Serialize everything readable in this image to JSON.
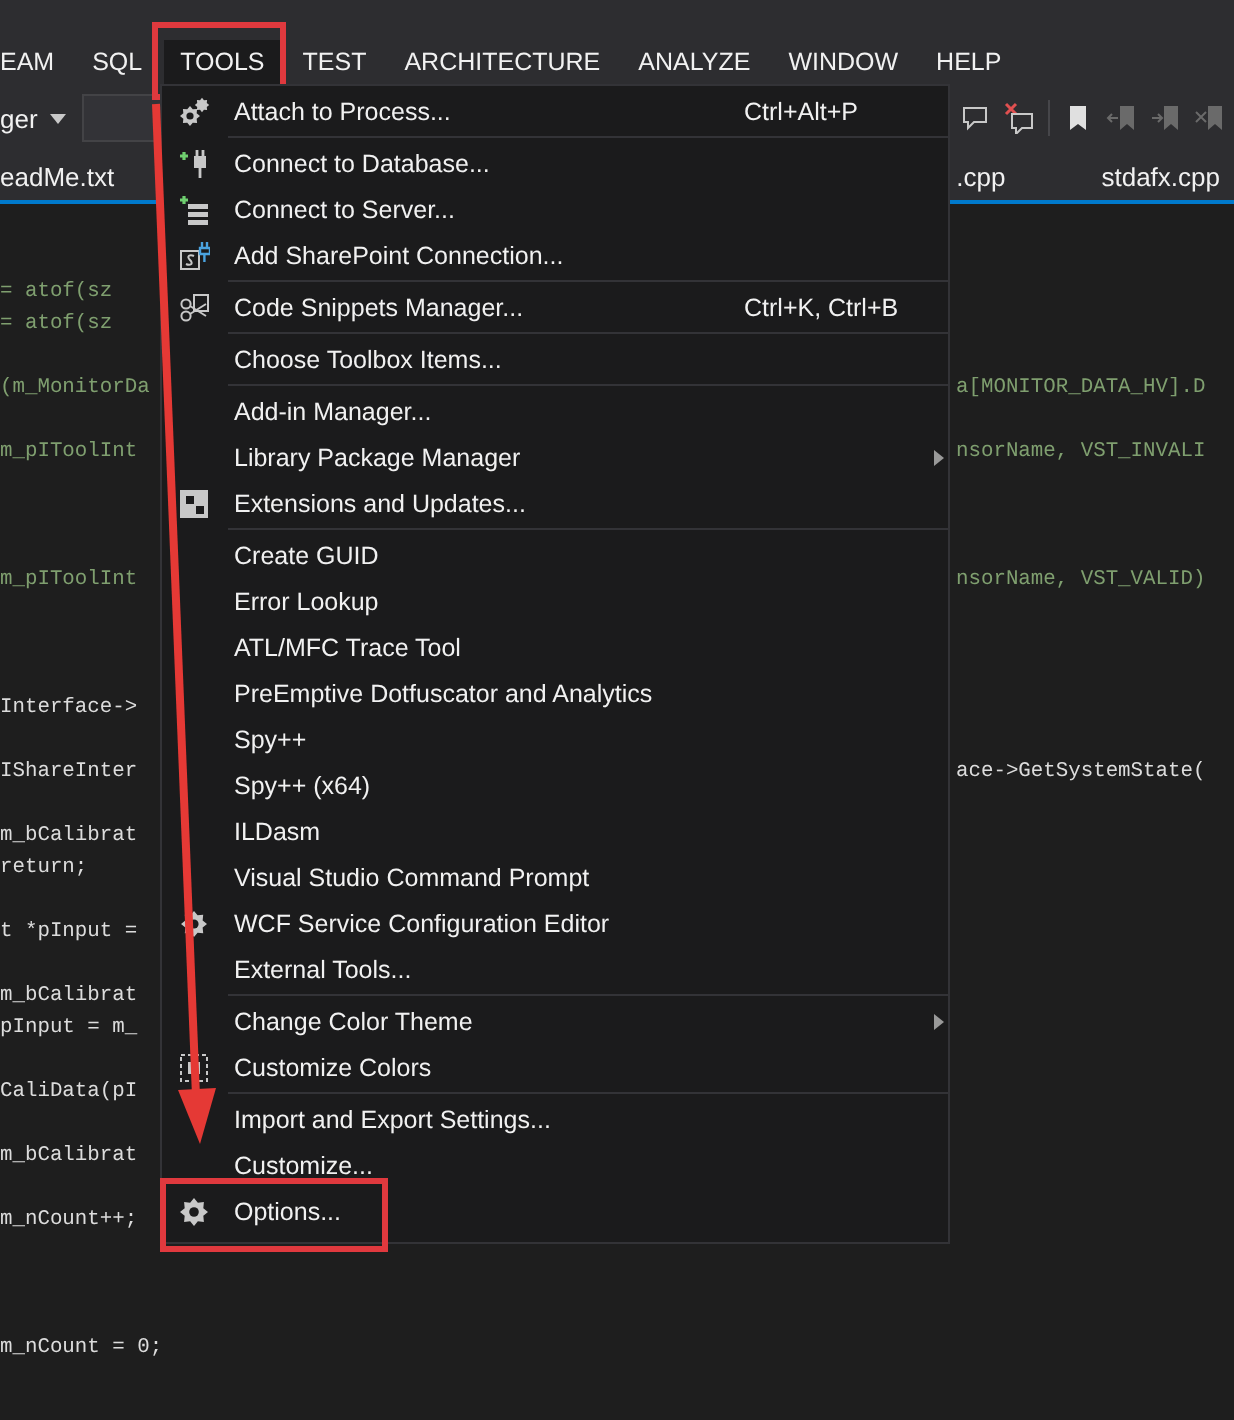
{
  "menu_bar": [
    {
      "label": "EAM",
      "selected": false,
      "highlighted": false
    },
    {
      "label": "SQL",
      "selected": false,
      "highlighted": false
    },
    {
      "label": "TOOLS",
      "selected": true,
      "highlighted": true
    },
    {
      "label": "TEST",
      "selected": false,
      "highlighted": false
    },
    {
      "label": "ARCHITECTURE",
      "selected": false,
      "highlighted": false
    },
    {
      "label": "ANALYZE",
      "selected": false,
      "highlighted": false
    },
    {
      "label": "WINDOW",
      "selected": false,
      "highlighted": false
    },
    {
      "label": "HELP",
      "selected": false,
      "highlighted": false
    }
  ],
  "toolbar": {
    "configuration": "ger"
  },
  "tabs": [
    {
      "label": "eadMe.txt"
    },
    {
      "label": ".cpp"
    },
    {
      "label": "stdafx.cpp"
    }
  ],
  "code_lines": [
    {
      "left": "= atof(sz",
      "inactive": true
    },
    {
      "left": "= atof(sz",
      "inactive": true
    },
    {
      "left": "(m_MonitorDa",
      "right": "a[MONITOR_DATA_HV].D",
      "inactive": true
    },
    {
      "left": "m_pIToolInt",
      "right": "nsorName, VST_INVALI",
      "inactive": true
    },
    {
      "left": "m_pIToolInt",
      "right": "nsorName, VST_VALID)",
      "inactive": true
    },
    {
      "left": "Interface->",
      "inactive": false
    },
    {
      "left": "IShareInter",
      "right": "ace->GetSystemState(",
      "inactive": false
    },
    {
      "left": "m_bCalibrat",
      "inactive": false
    },
    {
      "left": "return;",
      "inactive": false
    },
    {
      "left": "t *pInput =",
      "inactive": false
    },
    {
      "left": "m_bCalibrat",
      "inactive": false
    },
    {
      "left": "pInput = m_",
      "inactive": false
    },
    {
      "left": "CaliData(pI",
      "inactive": false
    },
    {
      "left": "m_bCalibrat",
      "inactive": false
    },
    {
      "left": "m_nCount++;",
      "inactive": false
    },
    {
      "left": "m_nCount = 0;",
      "inactive": false
    }
  ],
  "tools_menu": {
    "groups": [
      [
        {
          "label": "Attach to Process...",
          "shortcut": "Ctrl+Alt+P",
          "kind": "process",
          "submenu": false,
          "highlighted": false
        }
      ],
      [
        {
          "label": "Connect to Database...",
          "kind": "database",
          "submenu": false,
          "highlighted": false
        },
        {
          "label": "Connect to Server...",
          "kind": "server",
          "submenu": false,
          "highlighted": false
        },
        {
          "label": "Add SharePoint Connection...",
          "kind": "sharepoint",
          "submenu": false,
          "highlighted": false
        }
      ],
      [
        {
          "label": "Code Snippets Manager...",
          "shortcut": "Ctrl+K, Ctrl+B",
          "kind": "snippets",
          "submenu": false,
          "highlighted": false
        }
      ],
      [
        {
          "label": "Choose Toolbox Items...",
          "kind": "plain",
          "submenu": false,
          "highlighted": false
        }
      ],
      [
        {
          "label": "Add-in Manager...",
          "kind": "plain",
          "submenu": false,
          "highlighted": false
        },
        {
          "label": "Library Package Manager",
          "kind": "plain",
          "submenu": true,
          "highlighted": false
        },
        {
          "label": "Extensions and Updates...",
          "kind": "extensions",
          "submenu": false,
          "highlighted": false
        }
      ],
      [
        {
          "label": "Create GUID",
          "kind": "plain",
          "submenu": false,
          "highlighted": false
        },
        {
          "label": "Error Lookup",
          "kind": "plain",
          "submenu": false,
          "highlighted": false
        },
        {
          "label": "ATL/MFC Trace Tool",
          "kind": "plain",
          "submenu": false,
          "highlighted": false
        },
        {
          "label": "PreEmptive Dotfuscator and Analytics",
          "kind": "plain",
          "submenu": false,
          "highlighted": false
        },
        {
          "label": "Spy++",
          "kind": "plain",
          "submenu": false,
          "highlighted": false
        },
        {
          "label": "Spy++ (x64)",
          "kind": "plain",
          "submenu": false,
          "highlighted": false
        },
        {
          "label": "ILDasm",
          "kind": "plain",
          "submenu": false,
          "highlighted": false
        },
        {
          "label": "Visual Studio Command Prompt",
          "kind": "plain",
          "submenu": false,
          "highlighted": false
        },
        {
          "label": "WCF Service Configuration Editor",
          "kind": "wcf",
          "submenu": false,
          "highlighted": false
        },
        {
          "label": "External Tools...",
          "kind": "plain",
          "submenu": false,
          "highlighted": false
        }
      ],
      [
        {
          "label": "Change Color Theme",
          "kind": "plain",
          "submenu": true,
          "highlighted": false
        },
        {
          "label": "Customize Colors",
          "kind": "colors",
          "submenu": false,
          "highlighted": false
        }
      ],
      [
        {
          "label": "Import and Export Settings...",
          "kind": "plain",
          "submenu": false,
          "highlighted": false
        },
        {
          "label": "Customize...",
          "kind": "plain",
          "submenu": false,
          "highlighted": false
        },
        {
          "label": "Options...",
          "kind": "options",
          "submenu": false,
          "highlighted": true
        }
      ]
    ]
  }
}
